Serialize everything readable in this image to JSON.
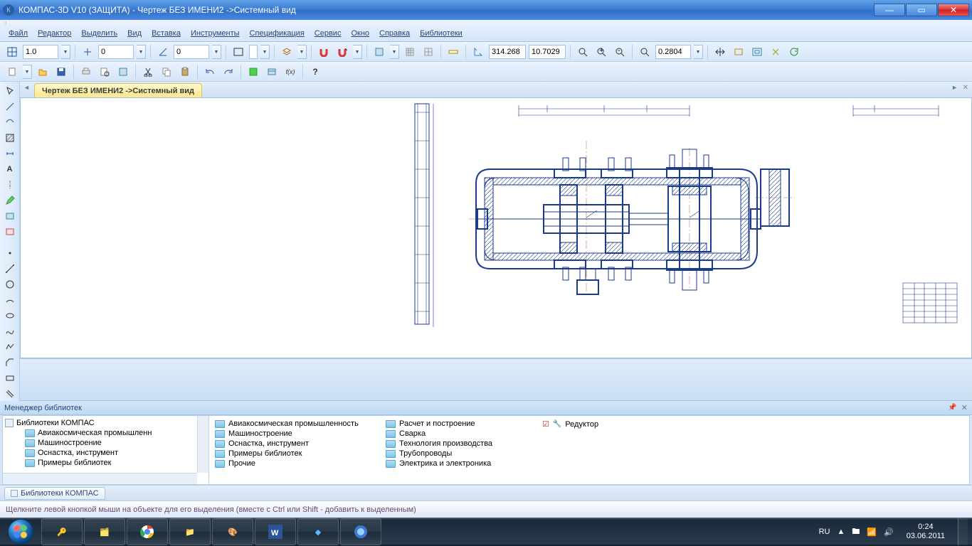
{
  "window": {
    "title": "КОМПАС-3D V10 (ЗАЩИТА) - Чертеж БЕЗ ИМЕНИ2 ->Системный вид"
  },
  "menu": {
    "items": [
      "Файл",
      "Редактор",
      "Выделить",
      "Вид",
      "Вставка",
      "Инструменты",
      "Спецификация",
      "Сервис",
      "Окно",
      "Справка",
      "Библиотеки"
    ]
  },
  "toolbar1": {
    "val1": "1.0",
    "val2": "0",
    "val3": "0",
    "coordX": "314.268",
    "coordY": "10.7029",
    "zoom": "0.2804"
  },
  "doc_tab": "Чертеж БЕЗ ИМЕНИ2 ->Системный вид",
  "libmgr": {
    "title": "Менеджер библиотек",
    "root": "Библиотеки КОМПАС",
    "tree": [
      "Авиакосмическая промышленн",
      "Машиностроение",
      "Оснастка, инструмент",
      "Примеры библиотек"
    ],
    "col1": [
      "Авиакосмическая промышленность",
      "Машиностроение",
      "Оснастка, инструмент",
      "Примеры библиотек",
      "Прочие"
    ],
    "col2": [
      "Расчет и построение",
      "Сварка",
      "Технология производства",
      "Трубопроводы",
      "Электрика и электроника"
    ],
    "col3": "Редуктор",
    "bottom_tab": "Библиотеки КОМПАС"
  },
  "hint": "Щелкните левой кнопкой мыши на объекте для его выделения (вместе с Ctrl или Shift - добавить к выделенным)",
  "tray": {
    "lang": "RU",
    "time": "0:24",
    "date": "03.06.2011"
  }
}
